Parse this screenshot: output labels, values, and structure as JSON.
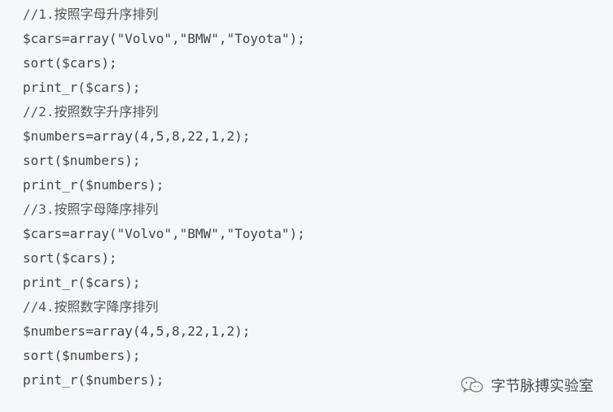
{
  "code": {
    "lines": [
      "//1.按照字母升序排列",
      "$cars=array(\"Volvo\",\"BMW\",\"Toyota\");",
      "sort($cars);",
      "print_r($cars);",
      "//2.按照数字升序排列",
      "$numbers=array(4,5,8,22,1,2);",
      "sort($numbers);",
      "print_r($numbers);",
      "//3.按照字母降序排列",
      "$cars=array(\"Volvo\",\"BMW\",\"Toyota\");",
      "sort($cars);",
      "print_r($cars);",
      "//4.按照数字降序排列",
      "$numbers=array(4,5,8,22,1,2);",
      "sort($numbers);",
      "print_r($numbers);"
    ]
  },
  "watermark": {
    "icon": "wechat-icon",
    "text": "字节脉搏实验室"
  },
  "colors": {
    "panel_background": "#f5f6f8",
    "code_text": "#444444"
  }
}
